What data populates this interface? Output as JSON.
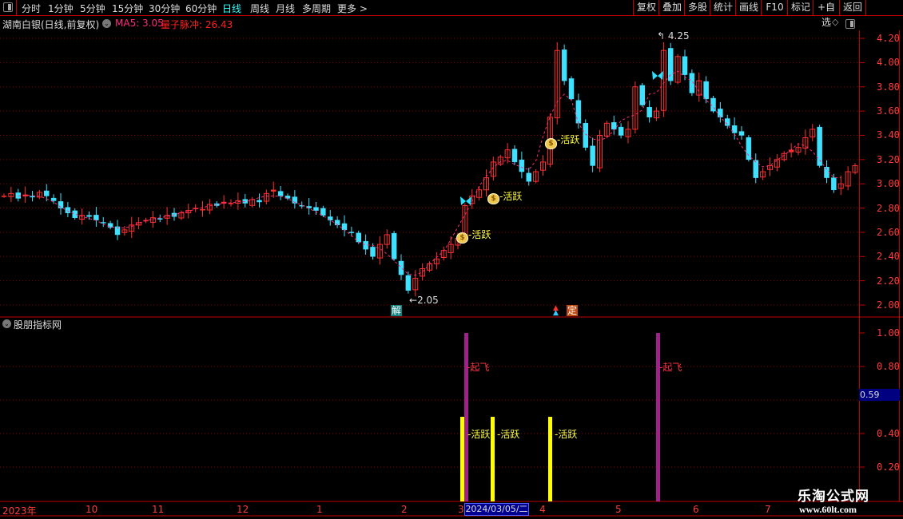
{
  "toolbar": {
    "periods": [
      "分时",
      "1分钟",
      "5分钟",
      "15分钟",
      "30分钟",
      "60分钟",
      "日线",
      "周线",
      "月线",
      "多周期",
      "更多 >"
    ],
    "active_period": "日线",
    "right_buttons": [
      "复权",
      "叠加",
      "多股",
      "统计",
      "画线",
      "F10",
      "标记",
      "+自选",
      "返回"
    ]
  },
  "main_panel": {
    "title": "湖南白银(日线,前复权)",
    "ma_label": "MA5: 3.05",
    "indicator_label": "量子脉冲: 26.43",
    "price_ticks": [
      "4.20",
      "4.00",
      "3.80",
      "3.60",
      "3.40",
      "3.20",
      "3.00",
      "2.80",
      "2.60",
      "2.40",
      "2.20",
      "2.00"
    ],
    "high_annotation": "4.25",
    "low_annotation": "2.05",
    "signal_label": "活跃",
    "tag_jie": "解",
    "tag_ding": "定",
    "closes": [
      2.9,
      2.92,
      2.88,
      2.91,
      2.89,
      2.93,
      2.9,
      2.86,
      2.8,
      2.76,
      2.72,
      2.74,
      2.73,
      2.7,
      2.68,
      2.64,
      2.58,
      2.62,
      2.66,
      2.68,
      2.7,
      2.72,
      2.71,
      2.74,
      2.73,
      2.76,
      2.78,
      2.8,
      2.79,
      2.83,
      2.82,
      2.85,
      2.84,
      2.86,
      2.84,
      2.87,
      2.85,
      2.92,
      2.95,
      2.9,
      2.88,
      2.84,
      2.82,
      2.8,
      2.78,
      2.74,
      2.7,
      2.66,
      2.62,
      2.6,
      2.52,
      2.46,
      2.4,
      2.5,
      2.58,
      2.38,
      2.25,
      2.12,
      2.22,
      2.3,
      2.34,
      2.38,
      2.45,
      2.5,
      2.55,
      2.82,
      2.9,
      2.95,
      3.05,
      3.18,
      3.22,
      3.28,
      3.18,
      3.1,
      3.02,
      3.1,
      3.18,
      3.55,
      4.1,
      3.85,
      3.7,
      3.5,
      3.3,
      3.15,
      3.4,
      3.5,
      3.45,
      3.4,
      3.45,
      3.8,
      3.65,
      3.55,
      3.6,
      4.1,
      3.85,
      4.05,
      3.9,
      3.75,
      3.85,
      3.7,
      3.6,
      3.55,
      3.48,
      3.42,
      3.4,
      3.2,
      3.05,
      3.1,
      3.15,
      3.2,
      3.25,
      3.28,
      3.3,
      3.38,
      3.45,
      3.15,
      3.05,
      2.95,
      3.0,
      3.1,
      3.15
    ],
    "colors": {
      "up": "#ff3030",
      "down": "#40e0ff",
      "ma": "#ff2a7a",
      "grid": "#8b0000",
      "axis": "#c00000"
    }
  },
  "sub_panel": {
    "title": "股朋指标网",
    "ticks": [
      "1.00",
      "0.80",
      "0.40",
      "0.20"
    ],
    "current_value": "0.59",
    "label_takeoff": "起飞",
    "label_active": "活跃",
    "bars": [
      {
        "type": "活跃",
        "value": 0.5,
        "color": "#ffff00"
      },
      {
        "type": "起飞",
        "value": 1.0,
        "color": "#a0208c"
      },
      {
        "type": "活跃",
        "value": 0.5,
        "color": "#ffff00"
      },
      {
        "type": "活跃",
        "value": 0.5,
        "color": "#ffff00"
      },
      {
        "type": "起飞",
        "value": 1.0,
        "color": "#a0208c"
      }
    ]
  },
  "date_axis": {
    "labels": [
      "2023年",
      "10",
      "11",
      "12",
      "1",
      "2",
      "3",
      "4",
      "5",
      "6",
      "7"
    ],
    "cursor_date": "2024/03/05/二"
  },
  "watermark": {
    "name": "乐淘公式网",
    "url": "www.60lt.com"
  }
}
